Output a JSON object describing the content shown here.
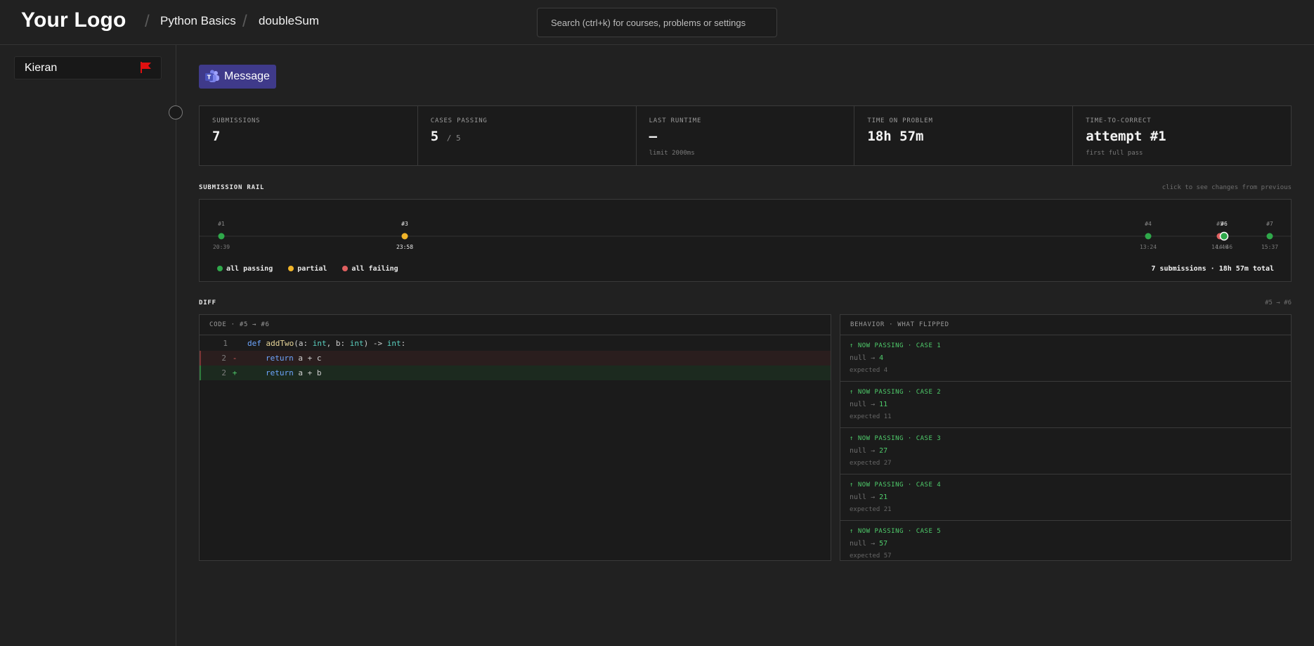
{
  "header": {
    "logo": "Your Logo",
    "breadcrumbs": [
      "Python Basics",
      "doubleSum"
    ],
    "search_placeholder": "Search (ctrl+k) for courses, problems or settings"
  },
  "sidebar": {
    "student_name": "Kieran",
    "flag_color": "#e01010"
  },
  "message_button": {
    "label": "Message",
    "icon": "teams-icon",
    "color": "#3f3a8a"
  },
  "stats": [
    {
      "label": "SUBMISSIONS",
      "value": "7",
      "of": "",
      "sub": ""
    },
    {
      "label": "CASES PASSING",
      "value": "5",
      "of": "/ 5",
      "sub": ""
    },
    {
      "label": "LAST RUNTIME",
      "value": "—",
      "of": "",
      "sub": "limit 2000ms"
    },
    {
      "label": "TIME ON PROBLEM",
      "value": "18h 57m",
      "of": "",
      "sub": ""
    },
    {
      "label": "TIME-TO-CORRECT",
      "value": "attempt #1",
      "of": "",
      "sub": "first full pass"
    }
  ],
  "rail": {
    "title": "SUBMISSION RAIL",
    "hint": "click to see changes from previous",
    "submissions": [
      {
        "label": "#1",
        "time": "20:39",
        "status": "pass"
      },
      {
        "label": "#3",
        "time": "23:58",
        "status": "partial"
      },
      {
        "label": "#4",
        "time": "13:24",
        "status": "pass"
      },
      {
        "label": "#5",
        "time": "14:46",
        "status": "fail"
      },
      {
        "label": "#6",
        "time": "14:46",
        "status": "pass"
      },
      {
        "label": "#7",
        "time": "15:37",
        "status": "pass"
      }
    ],
    "legend": [
      "all passing",
      "partial",
      "all failing"
    ],
    "total": "7 submissions · 18h 57m total",
    "colors": {
      "pass": "#2fa84a",
      "partial": "#f0b429",
      "fail": "#e06060"
    }
  },
  "diff": {
    "title": "DIFF",
    "range": "#5 → #6",
    "code_head": "CODE · #5 → #6",
    "behavior_head": "BEHAVIOR · WHAT FLIPPED",
    "code": {
      "line1_num": "1",
      "line2_num": "2",
      "line3_num": "2",
      "del_marker": "-",
      "add_marker": "+",
      "def": "def",
      "fname": "addTwo",
      "p1": "(a: ",
      "int": "int",
      "p2": ", b: ",
      "p3": ") -> ",
      "p4": ":",
      "ret": "return",
      "del_expr": " a + c",
      "add_expr": " a + b"
    },
    "cases": [
      {
        "title": "↑ NOW PASSING · CASE 1",
        "from": "null →",
        "to": "4",
        "expected": "expected 4"
      },
      {
        "title": "↑ NOW PASSING · CASE 2",
        "from": "null →",
        "to": "11",
        "expected": "expected 11"
      },
      {
        "title": "↑ NOW PASSING · CASE 3",
        "from": "null →",
        "to": "27",
        "expected": "expected 27"
      },
      {
        "title": "↑ NOW PASSING · CASE 4",
        "from": "null →",
        "to": "21",
        "expected": "expected 21"
      },
      {
        "title": "↑ NOW PASSING · CASE 5",
        "from": "null →",
        "to": "57",
        "expected": "expected 57"
      }
    ]
  }
}
